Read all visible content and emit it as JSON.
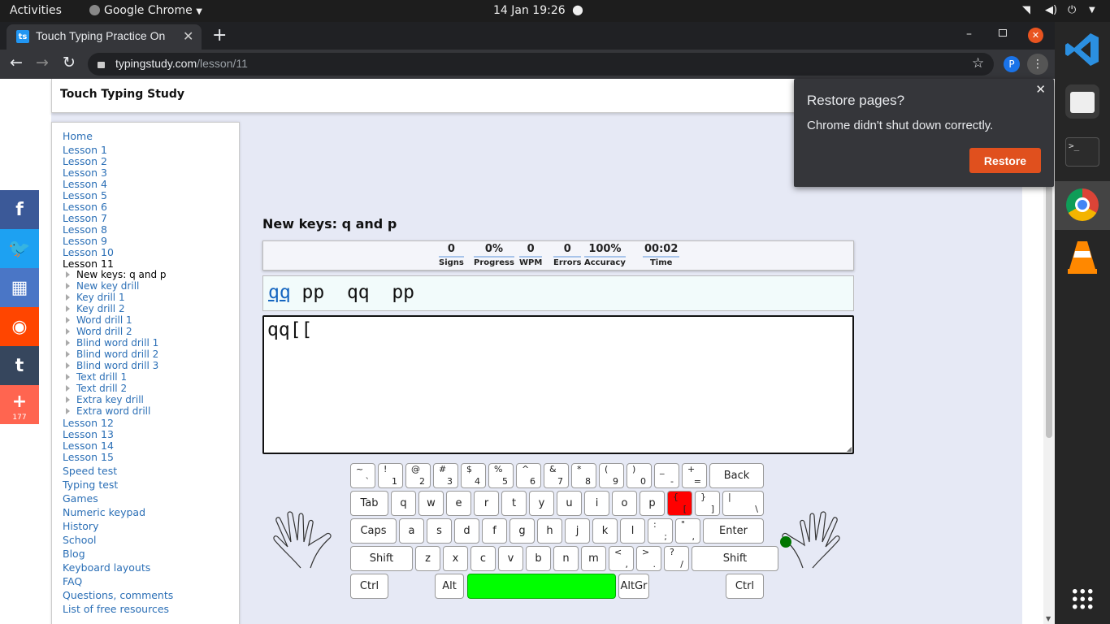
{
  "system_bar": {
    "activities": "Activities",
    "app": "Google Chrome",
    "datetime": "14 Jan  19:26"
  },
  "browser": {
    "tab_title": "Touch Typing Practice On",
    "tab_favicon": "ts",
    "url_domain": "typingstudy.com",
    "url_path": "/lesson/11",
    "profile_initial": "P",
    "colors": {
      "close_tab": "#e95420",
      "profile": "#1a73e8"
    }
  },
  "site": {
    "title": "Touch Typing Study"
  },
  "sidebar": {
    "top": [
      "Home",
      "Lesson 1",
      "Lesson 2",
      "Lesson 3",
      "Lesson 4",
      "Lesson 5",
      "Lesson 6",
      "Lesson 7",
      "Lesson 8",
      "Lesson 9",
      "Lesson 10",
      "Lesson 11"
    ],
    "sub": [
      "New keys: q and p",
      "New key drill",
      "Key drill 1",
      "Key drill 2",
      "Word drill 1",
      "Word drill 2",
      "Blind word drill 1",
      "Blind word drill 2",
      "Blind word drill 3",
      "Text drill 1",
      "Text drill 2",
      "Extra key drill",
      "Extra word drill"
    ],
    "after_lessons": [
      "Lesson 12",
      "Lesson 13",
      "Lesson 14",
      "Lesson 15"
    ],
    "links": [
      "Speed test",
      "Typing test",
      "Games",
      "Numeric keypad",
      "History",
      "School",
      "Blog",
      "Keyboard layouts",
      "FAQ",
      "Questions, comments",
      "List of free resources"
    ]
  },
  "social": {
    "share_count": "177",
    "buttons": [
      {
        "name": "facebook",
        "glyph": "f",
        "color": "#3b5998"
      },
      {
        "name": "twitter",
        "glyph": "🐦",
        "color": "#1da1f2"
      },
      {
        "name": "apps",
        "glyph": "▦",
        "color": "#4a76c6"
      },
      {
        "name": "reddit",
        "glyph": "◉",
        "color": "#ff4500"
      },
      {
        "name": "tumblr",
        "glyph": "t",
        "color": "#36465d"
      },
      {
        "name": "more",
        "glyph": "+",
        "color": "#ff6550"
      }
    ]
  },
  "lesson": {
    "heading": "New keys: q and p",
    "stats": [
      {
        "value": "0",
        "label": "Signs"
      },
      {
        "value": "0%",
        "label": "Progress"
      },
      {
        "value": "0",
        "label": "WPM"
      },
      {
        "value": "0",
        "label": "Errors"
      },
      {
        "value": "100%",
        "label": "Accuracy"
      },
      {
        "value": "00:02",
        "label": "Time"
      }
    ],
    "current_word": "qq",
    "remaining_text": " pp  qq  pp",
    "typed": "qq[["
  },
  "keyboard": {
    "rows": [
      [
        {
          "top": "~",
          "bottom": "`"
        },
        {
          "top": "!",
          "bottom": "1"
        },
        {
          "top": "@",
          "bottom": "2"
        },
        {
          "top": "#",
          "bottom": "3"
        },
        {
          "top": "$",
          "bottom": "4"
        },
        {
          "top": "%",
          "bottom": "5"
        },
        {
          "top": "^",
          "bottom": "6"
        },
        {
          "top": "&",
          "bottom": "7"
        },
        {
          "top": "*",
          "bottom": "8"
        },
        {
          "top": "(",
          "bottom": "9"
        },
        {
          "top": ")",
          "bottom": "0"
        },
        {
          "top": "_",
          "bottom": "-"
        },
        {
          "top": "+",
          "bottom": "="
        },
        {
          "label": "Back"
        }
      ],
      [
        {
          "label": "Tab"
        },
        {
          "label": "q"
        },
        {
          "label": "w"
        },
        {
          "label": "e"
        },
        {
          "label": "r"
        },
        {
          "label": "t"
        },
        {
          "label": "y"
        },
        {
          "label": "u"
        },
        {
          "label": "i"
        },
        {
          "label": "o"
        },
        {
          "label": "p"
        },
        {
          "top": "{",
          "bottom": "[",
          "highlight": true
        },
        {
          "top": "}",
          "bottom": "]"
        },
        {
          "top": "|",
          "bottom": "\\"
        }
      ],
      [
        {
          "label": "Caps"
        },
        {
          "label": "a"
        },
        {
          "label": "s"
        },
        {
          "label": "d"
        },
        {
          "label": "f"
        },
        {
          "label": "g"
        },
        {
          "label": "h"
        },
        {
          "label": "j"
        },
        {
          "label": "k"
        },
        {
          "label": "l"
        },
        {
          "top": ":",
          "bottom": ";"
        },
        {
          "top": "\"",
          "bottom": ","
        },
        {
          "label": "Enter"
        }
      ],
      [
        {
          "label": "Shift"
        },
        {
          "label": "z"
        },
        {
          "label": "x"
        },
        {
          "label": "c"
        },
        {
          "label": "v"
        },
        {
          "label": "b"
        },
        {
          "label": "n"
        },
        {
          "label": "m"
        },
        {
          "top": "<",
          "bottom": ","
        },
        {
          "top": ">",
          "bottom": "."
        },
        {
          "top": "?",
          "bottom": "/"
        },
        {
          "label": "Shift"
        }
      ],
      [
        {
          "label": "Ctrl"
        },
        {
          "label": "Alt"
        },
        {
          "label": "",
          "space": true
        },
        {
          "label": "AltGr"
        },
        {
          "label": "Ctrl"
        }
      ]
    ],
    "colors": {
      "error_key": "#ff0000",
      "space_key": "#00ff00",
      "finger_dot": "#007700"
    }
  },
  "restore_popup": {
    "title": "Restore pages?",
    "message": "Chrome didn't shut down correctly.",
    "button": "Restore",
    "button_color": "#e0501e"
  },
  "dock": {
    "apps": [
      "vscode-icon",
      "files-icon",
      "terminal-icon",
      "chrome-icon",
      "vlc-icon"
    ],
    "terminal_glyph": ">_"
  }
}
